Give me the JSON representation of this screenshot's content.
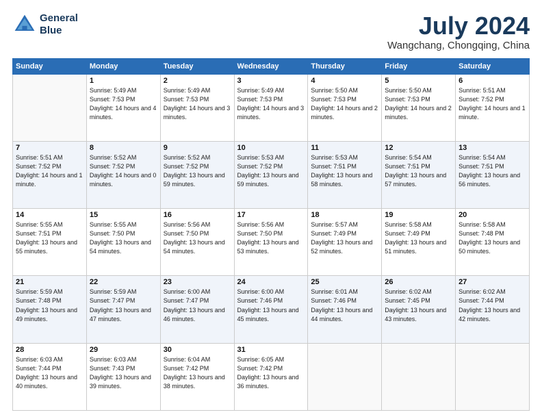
{
  "logo": {
    "line1": "General",
    "line2": "Blue"
  },
  "title": "July 2024",
  "location": "Wangchang, Chongqing, China",
  "headers": [
    "Sunday",
    "Monday",
    "Tuesday",
    "Wednesday",
    "Thursday",
    "Friday",
    "Saturday"
  ],
  "weeks": [
    [
      {
        "day": "",
        "sunrise": "",
        "sunset": "",
        "daylight": ""
      },
      {
        "day": "1",
        "sunrise": "Sunrise: 5:49 AM",
        "sunset": "Sunset: 7:53 PM",
        "daylight": "Daylight: 14 hours and 4 minutes."
      },
      {
        "day": "2",
        "sunrise": "Sunrise: 5:49 AM",
        "sunset": "Sunset: 7:53 PM",
        "daylight": "Daylight: 14 hours and 3 minutes."
      },
      {
        "day": "3",
        "sunrise": "Sunrise: 5:49 AM",
        "sunset": "Sunset: 7:53 PM",
        "daylight": "Daylight: 14 hours and 3 minutes."
      },
      {
        "day": "4",
        "sunrise": "Sunrise: 5:50 AM",
        "sunset": "Sunset: 7:53 PM",
        "daylight": "Daylight: 14 hours and 2 minutes."
      },
      {
        "day": "5",
        "sunrise": "Sunrise: 5:50 AM",
        "sunset": "Sunset: 7:53 PM",
        "daylight": "Daylight: 14 hours and 2 minutes."
      },
      {
        "day": "6",
        "sunrise": "Sunrise: 5:51 AM",
        "sunset": "Sunset: 7:52 PM",
        "daylight": "Daylight: 14 hours and 1 minute."
      }
    ],
    [
      {
        "day": "7",
        "sunrise": "Sunrise: 5:51 AM",
        "sunset": "Sunset: 7:52 PM",
        "daylight": "Daylight: 14 hours and 1 minute."
      },
      {
        "day": "8",
        "sunrise": "Sunrise: 5:52 AM",
        "sunset": "Sunset: 7:52 PM",
        "daylight": "Daylight: 14 hours and 0 minutes."
      },
      {
        "day": "9",
        "sunrise": "Sunrise: 5:52 AM",
        "sunset": "Sunset: 7:52 PM",
        "daylight": "Daylight: 13 hours and 59 minutes."
      },
      {
        "day": "10",
        "sunrise": "Sunrise: 5:53 AM",
        "sunset": "Sunset: 7:52 PM",
        "daylight": "Daylight: 13 hours and 59 minutes."
      },
      {
        "day": "11",
        "sunrise": "Sunrise: 5:53 AM",
        "sunset": "Sunset: 7:51 PM",
        "daylight": "Daylight: 13 hours and 58 minutes."
      },
      {
        "day": "12",
        "sunrise": "Sunrise: 5:54 AM",
        "sunset": "Sunset: 7:51 PM",
        "daylight": "Daylight: 13 hours and 57 minutes."
      },
      {
        "day": "13",
        "sunrise": "Sunrise: 5:54 AM",
        "sunset": "Sunset: 7:51 PM",
        "daylight": "Daylight: 13 hours and 56 minutes."
      }
    ],
    [
      {
        "day": "14",
        "sunrise": "Sunrise: 5:55 AM",
        "sunset": "Sunset: 7:51 PM",
        "daylight": "Daylight: 13 hours and 55 minutes."
      },
      {
        "day": "15",
        "sunrise": "Sunrise: 5:55 AM",
        "sunset": "Sunset: 7:50 PM",
        "daylight": "Daylight: 13 hours and 54 minutes."
      },
      {
        "day": "16",
        "sunrise": "Sunrise: 5:56 AM",
        "sunset": "Sunset: 7:50 PM",
        "daylight": "Daylight: 13 hours and 54 minutes."
      },
      {
        "day": "17",
        "sunrise": "Sunrise: 5:56 AM",
        "sunset": "Sunset: 7:50 PM",
        "daylight": "Daylight: 13 hours and 53 minutes."
      },
      {
        "day": "18",
        "sunrise": "Sunrise: 5:57 AM",
        "sunset": "Sunset: 7:49 PM",
        "daylight": "Daylight: 13 hours and 52 minutes."
      },
      {
        "day": "19",
        "sunrise": "Sunrise: 5:58 AM",
        "sunset": "Sunset: 7:49 PM",
        "daylight": "Daylight: 13 hours and 51 minutes."
      },
      {
        "day": "20",
        "sunrise": "Sunrise: 5:58 AM",
        "sunset": "Sunset: 7:48 PM",
        "daylight": "Daylight: 13 hours and 50 minutes."
      }
    ],
    [
      {
        "day": "21",
        "sunrise": "Sunrise: 5:59 AM",
        "sunset": "Sunset: 7:48 PM",
        "daylight": "Daylight: 13 hours and 49 minutes."
      },
      {
        "day": "22",
        "sunrise": "Sunrise: 5:59 AM",
        "sunset": "Sunset: 7:47 PM",
        "daylight": "Daylight: 13 hours and 47 minutes."
      },
      {
        "day": "23",
        "sunrise": "Sunrise: 6:00 AM",
        "sunset": "Sunset: 7:47 PM",
        "daylight": "Daylight: 13 hours and 46 minutes."
      },
      {
        "day": "24",
        "sunrise": "Sunrise: 6:00 AM",
        "sunset": "Sunset: 7:46 PM",
        "daylight": "Daylight: 13 hours and 45 minutes."
      },
      {
        "day": "25",
        "sunrise": "Sunrise: 6:01 AM",
        "sunset": "Sunset: 7:46 PM",
        "daylight": "Daylight: 13 hours and 44 minutes."
      },
      {
        "day": "26",
        "sunrise": "Sunrise: 6:02 AM",
        "sunset": "Sunset: 7:45 PM",
        "daylight": "Daylight: 13 hours and 43 minutes."
      },
      {
        "day": "27",
        "sunrise": "Sunrise: 6:02 AM",
        "sunset": "Sunset: 7:44 PM",
        "daylight": "Daylight: 13 hours and 42 minutes."
      }
    ],
    [
      {
        "day": "28",
        "sunrise": "Sunrise: 6:03 AM",
        "sunset": "Sunset: 7:44 PM",
        "daylight": "Daylight: 13 hours and 40 minutes."
      },
      {
        "day": "29",
        "sunrise": "Sunrise: 6:03 AM",
        "sunset": "Sunset: 7:43 PM",
        "daylight": "Daylight: 13 hours and 39 minutes."
      },
      {
        "day": "30",
        "sunrise": "Sunrise: 6:04 AM",
        "sunset": "Sunset: 7:42 PM",
        "daylight": "Daylight: 13 hours and 38 minutes."
      },
      {
        "day": "31",
        "sunrise": "Sunrise: 6:05 AM",
        "sunset": "Sunset: 7:42 PM",
        "daylight": "Daylight: 13 hours and 36 minutes."
      },
      {
        "day": "",
        "sunrise": "",
        "sunset": "",
        "daylight": ""
      },
      {
        "day": "",
        "sunrise": "",
        "sunset": "",
        "daylight": ""
      },
      {
        "day": "",
        "sunrise": "",
        "sunset": "",
        "daylight": ""
      }
    ]
  ]
}
